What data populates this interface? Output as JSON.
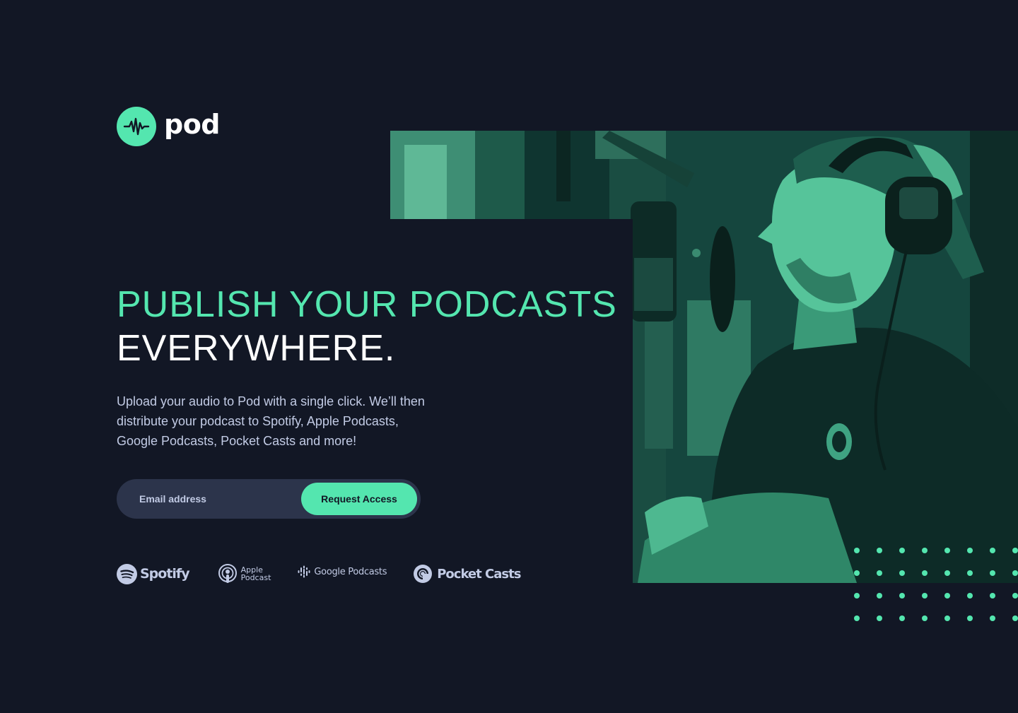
{
  "brand": {
    "name": "pod",
    "icon": "waveform-icon",
    "accent_color": "#54E6AF",
    "background_color": "#121725"
  },
  "hero": {
    "headline_line1": "PUBLISH YOUR PODCASTS",
    "headline_line2": "EVERYWHERE.",
    "description": "Upload your audio to Pod with a single click. We’ll then distribute your podcast to Spotify, Apple Podcasts, Google Podcasts, Pocket Casts and more!"
  },
  "signup": {
    "email_placeholder": "Email address",
    "button_label": "Request Access"
  },
  "platforms": {
    "spotify": {
      "label": "Spotify",
      "icon": "spotify-icon"
    },
    "apple": {
      "label_line1": "Apple",
      "label_line2": "Podcast",
      "icon": "apple-podcasts-icon"
    },
    "google": {
      "label": "Google Podcasts",
      "icon": "google-podcasts-icon"
    },
    "pocket": {
      "label": "Pocket Casts",
      "icon": "pocket-casts-icon"
    }
  },
  "image": {
    "subject": "podcaster-with-microphone-photo",
    "tint_color": "#54E6AF"
  }
}
